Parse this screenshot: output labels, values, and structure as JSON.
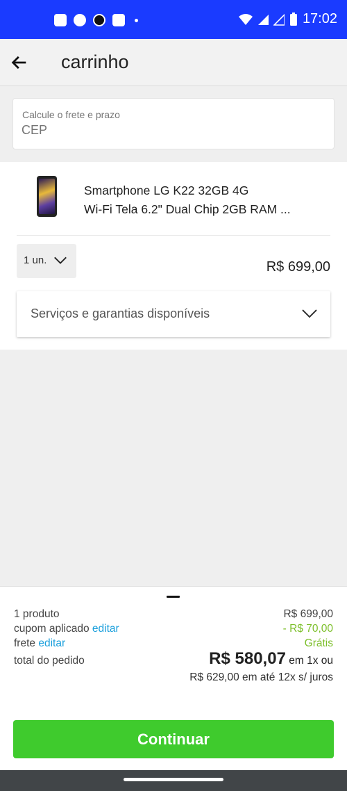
{
  "status_bar": {
    "time": "17:02",
    "left_icons": [
      "message-icon",
      "facebook-messenger-icon",
      "app-icon",
      "youtube-icon",
      "notification-dot-icon"
    ],
    "right_icons": [
      "wifi-icon",
      "signal-icon",
      "signal-icon",
      "battery-icon"
    ]
  },
  "app_bar": {
    "title": "carrinho"
  },
  "shipping": {
    "label": "Calcule o frete e prazo",
    "placeholder": "CEP"
  },
  "cart_item": {
    "name_line1": "Smartphone LG K22 32GB 4G",
    "name_line2": "Wi-Fi Tela 6.2\" Dual Chip 2GB RAM ...",
    "quantity": "1 un.",
    "price": "R$ 699,00",
    "services_label": "Serviços e garantias disponíveis"
  },
  "summary": {
    "products_label": "1 produto",
    "products_value": "R$ 699,00",
    "coupon_label": "cupom aplicado",
    "coupon_edit": "editar",
    "coupon_value": "- R$ 70,00",
    "shipping_label": "frete",
    "shipping_edit": "editar",
    "shipping_value": "Grátis",
    "total_label": "total do pedido",
    "total_value": "R$ 580,07",
    "total_suffix": "em 1x ou",
    "installments": "R$ 629,00 em até 12x s/ juros"
  },
  "continue_label": "Continuar",
  "colors": {
    "status_bar": "#1a3bff",
    "link": "#1a9fdc",
    "discount": "#7cbf2a",
    "button": "#3fcb2d"
  }
}
